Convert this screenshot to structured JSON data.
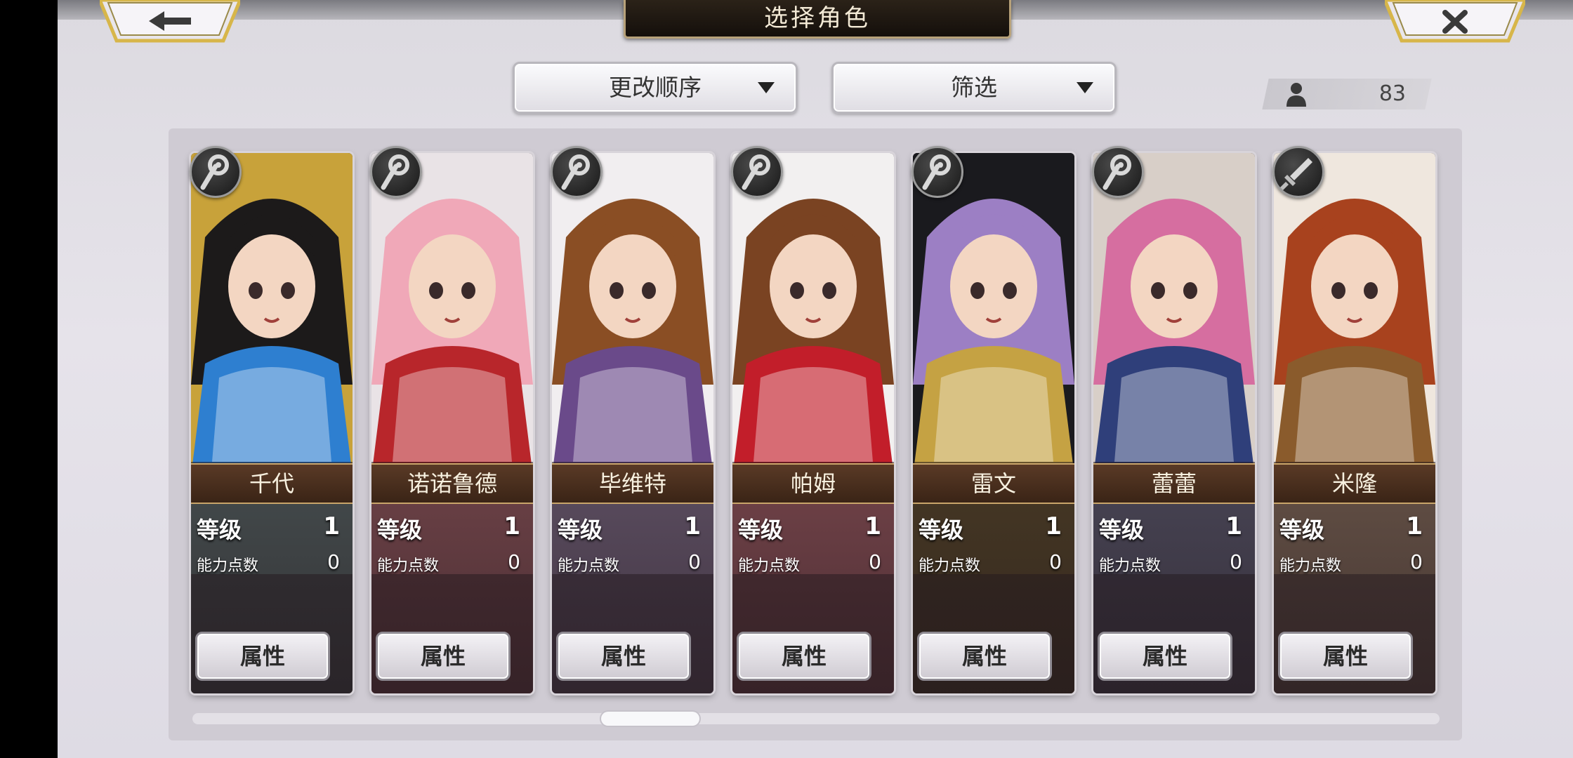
{
  "header": {
    "title": "选择角色"
  },
  "nav": {
    "back_icon": "left-arrow-icon",
    "close_icon": "close-x-icon"
  },
  "controls": {
    "sort_label": "更改顺序",
    "filter_label": "筛选"
  },
  "roster": {
    "count_icon": "person-icon",
    "count": "83"
  },
  "labels": {
    "level": "等级",
    "ability_points": "能力点数",
    "attributes": "属性"
  },
  "characters": [
    {
      "name": "千代",
      "level": "1",
      "ability_points": "0",
      "class_icon": "staff-icon",
      "hair": "#1c1a1a",
      "accent": "#2e7fd0",
      "bg": "#c8a23a"
    },
    {
      "name": "诺诺鲁德",
      "level": "1",
      "ability_points": "0",
      "class_icon": "staff-icon",
      "hair": "#f0a8b8",
      "accent": "#b8262b",
      "bg": "#e9e3e6"
    },
    {
      "name": "毕维特",
      "level": "1",
      "ability_points": "0",
      "class_icon": "staff-icon",
      "hair": "#8a4e24",
      "accent": "#6a4a8a",
      "bg": "#f1eef0"
    },
    {
      "name": "帕姆",
      "level": "1",
      "ability_points": "0",
      "class_icon": "staff-icon",
      "hair": "#7a4322",
      "accent": "#c21e2a",
      "bg": "#f2f0f0"
    },
    {
      "name": "雷文",
      "level": "1",
      "ability_points": "0",
      "class_icon": "staff-icon",
      "hair": "#9c7fc4",
      "accent": "#c5a243",
      "bg": "#1a1a1e"
    },
    {
      "name": "蕾蕾",
      "level": "1",
      "ability_points": "0",
      "class_icon": "staff-icon",
      "hair": "#d66ea0",
      "accent": "#2f3f7a",
      "bg": "#d8cfc8"
    },
    {
      "name": "米隆",
      "level": "1",
      "ability_points": "0",
      "class_icon": "sword-icon",
      "hair": "#a8421e",
      "accent": "#8a5b2c",
      "bg": "#efe7de"
    }
  ]
}
